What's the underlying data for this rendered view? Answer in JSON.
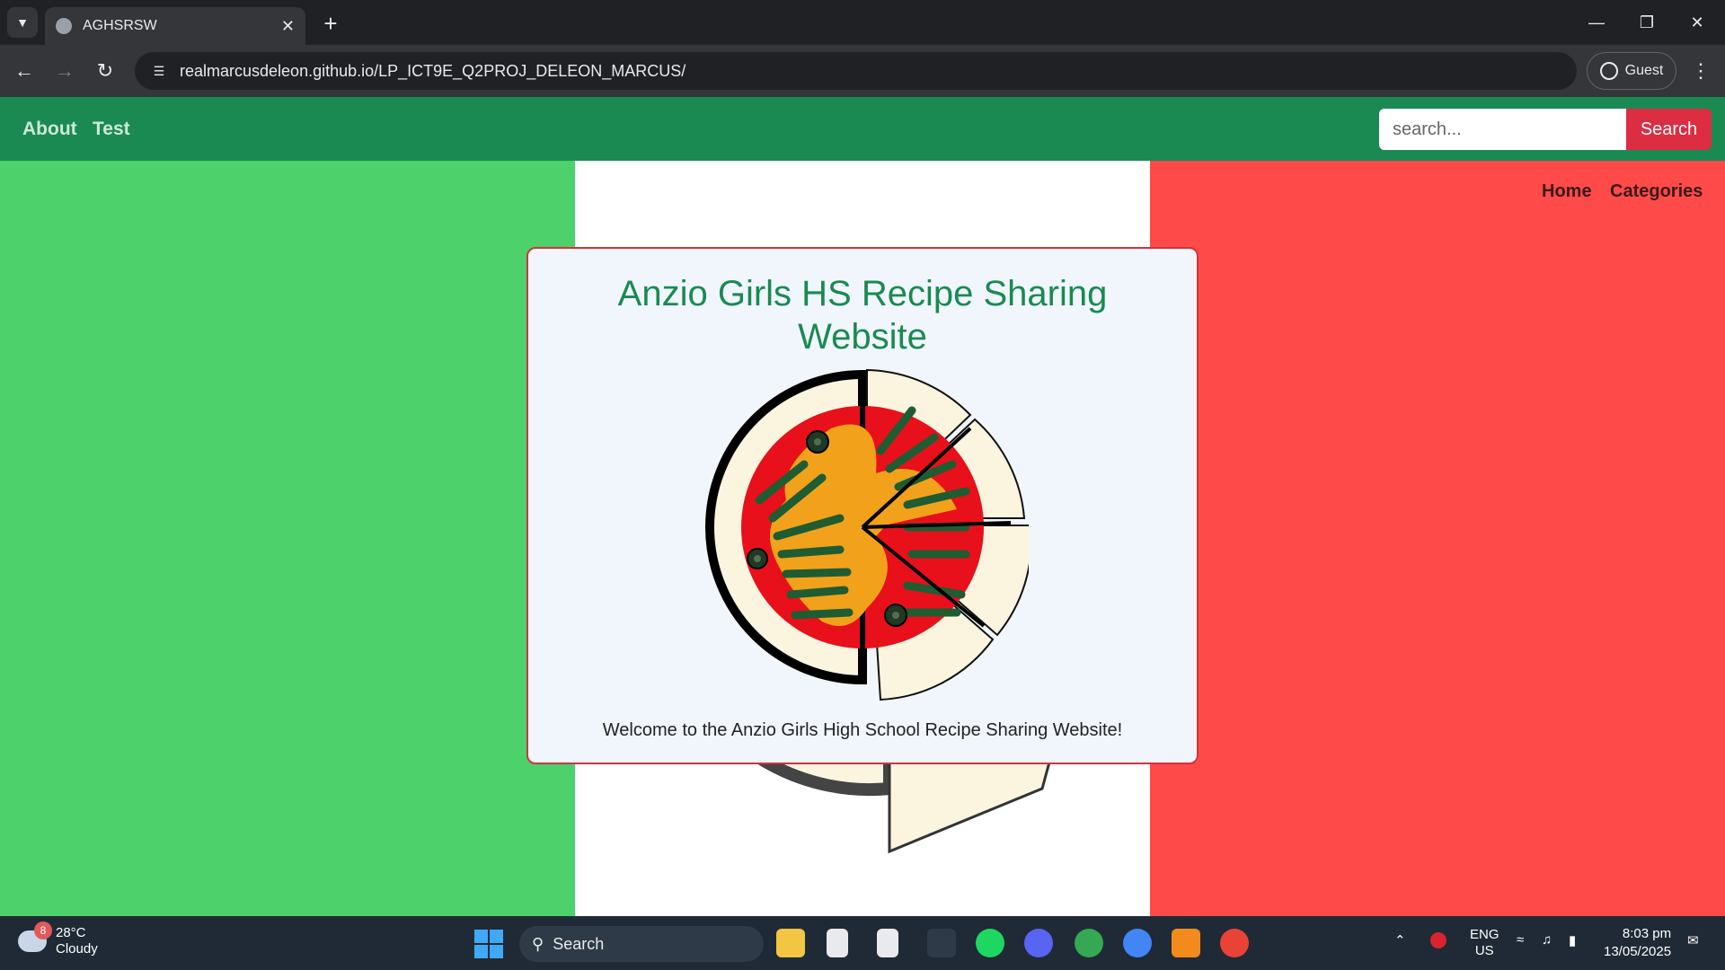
{
  "browser": {
    "tab_title": "AGHSRSW",
    "url": "realmarcusdeleon.github.io/LP_ICT9E_Q2PROJ_DELEON_MARCUS/",
    "profile_label": "Guest"
  },
  "site": {
    "nav": {
      "about": "About",
      "test": "Test"
    },
    "search": {
      "placeholder": "search...",
      "button": "Search"
    },
    "side_nav": {
      "home": "Home",
      "categories": "Categories"
    },
    "card": {
      "title": "Anzio Girls HS Recipe Sharing Website",
      "welcome": "Welcome to the Anzio Girls High School Recipe Sharing Website!"
    },
    "colors": {
      "nav": "#1a8a52",
      "flag_green": "#4cd16b",
      "flag_white": "#ffffff",
      "flag_red": "#ff4a4a",
      "search_button": "#dc2d43"
    }
  },
  "taskbar": {
    "weather": {
      "badge": "8",
      "temp": "28°C",
      "condition": "Cloudy"
    },
    "search_label": "Search",
    "lang": {
      "line1": "ENG",
      "line2": "US"
    },
    "clock": {
      "time": "8:03 pm",
      "date": "13/05/2025"
    }
  }
}
